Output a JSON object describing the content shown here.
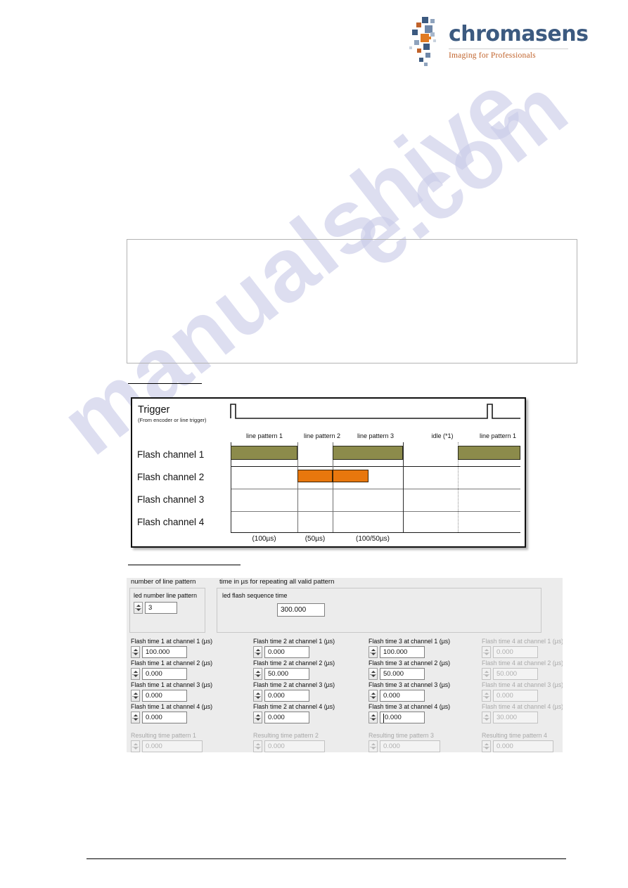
{
  "logo": {
    "name": "chromasens",
    "tagline": "Imaging for Professionals"
  },
  "watermark": {
    "line1": "manualshive",
    "line2": "e.com"
  },
  "diagram": {
    "trigger_title": "Trigger",
    "trigger_subtitle": "(From encoder or line trigger)",
    "channels": [
      "Flash channel 1",
      "Flash channel 2",
      "Flash channel 3",
      "Flash channel 4"
    ],
    "pattern_labels": [
      "line pattern 1",
      "line pattern 2",
      "line pattern 3",
      "idle (*1)",
      "line pattern 1"
    ],
    "time_labels": [
      "(100µs)",
      "(50µs)",
      "(100/50µs)"
    ],
    "colors": {
      "channel1_bar": "#8c8b4b",
      "channel2_bar": "#e8770d"
    }
  },
  "panel": {
    "group_count": {
      "caption": "number of line pattern",
      "field_label": "led number line pattern",
      "value": "3"
    },
    "group_sequence": {
      "caption": "time in µs for repeating all valid pattern",
      "field_label": "led flash sequence time",
      "value": "300.000"
    },
    "columns": [
      {
        "enabled": true,
        "fields": [
          {
            "label": "Flash time 1 at channel 1 (µs)",
            "value": "100.000"
          },
          {
            "label": "Flash time 1 at channel 2 (µs)",
            "value": "0.000"
          },
          {
            "label": "Flash time 1 at channel 3 (µs)",
            "value": "0.000"
          },
          {
            "label": "Flash time 1 at channel 4 (µs)",
            "value": "0.000"
          }
        ],
        "result": {
          "label": "Resulting time pattern 1",
          "value": "0.000"
        }
      },
      {
        "enabled": true,
        "fields": [
          {
            "label": "Flash time 2 at channel 1 (µs)",
            "value": "0.000"
          },
          {
            "label": "Flash time 2 at channel 2 (µs)",
            "value": "50.000"
          },
          {
            "label": "Flash time 2 at channel 3 (µs)",
            "value": "0.000"
          },
          {
            "label": "Flash time 2 at channel 4 (µs)",
            "value": "0.000"
          }
        ],
        "result": {
          "label": "Resulting time pattern 2",
          "value": "0.000"
        }
      },
      {
        "enabled": true,
        "fields": [
          {
            "label": "Flash time 3 at channel 1 (µs)",
            "value": "100.000"
          },
          {
            "label": "Flash time 3 at channel 2 (µs)",
            "value": "50.000"
          },
          {
            "label": "Flash time 3 at channel 3 (µs)",
            "value": "0.000"
          },
          {
            "label": "Flash time 3 at channel 4 (µs)",
            "value": "0.000"
          }
        ],
        "result": {
          "label": "Resulting time pattern 3",
          "value": "0.000"
        }
      },
      {
        "enabled": false,
        "fields": [
          {
            "label": "Flash time 4 at channel 1 (µs)",
            "value": "0.000"
          },
          {
            "label": "Flash time 4 at channel 2 (µs)",
            "value": "50.000"
          },
          {
            "label": "Flash time 4 at channel 3 (µs)",
            "value": "0.000"
          },
          {
            "label": "Flash time 4 at channel 4 (µs)",
            "value": "30.000"
          }
        ],
        "result": {
          "label": "Resulting time pattern 4",
          "value": "0.000"
        }
      }
    ]
  }
}
